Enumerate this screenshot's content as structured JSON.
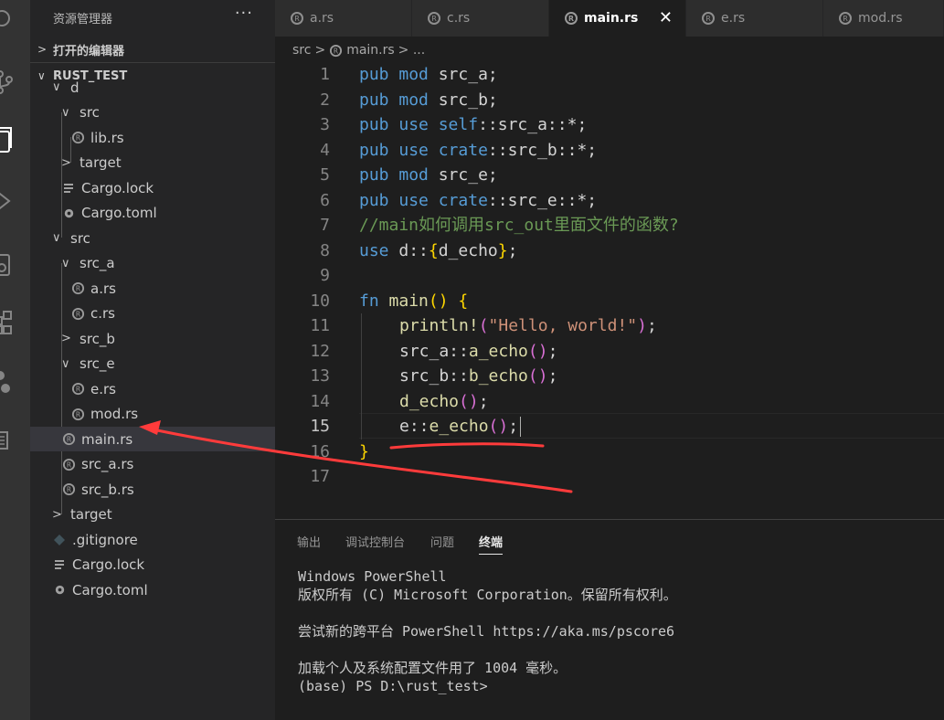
{
  "sidebar": {
    "title": "资源管理器",
    "more": "···",
    "open_editors": "打开的编辑器",
    "workspace": "RUST_TEST",
    "tree": [
      {
        "label": "d",
        "type": "folder",
        "open": true
      },
      {
        "label": "src",
        "type": "folder",
        "open": true
      },
      {
        "label": "lib.rs",
        "type": "rust"
      },
      {
        "label": "target",
        "type": "folder",
        "open": false
      },
      {
        "label": "Cargo.lock",
        "type": "lines"
      },
      {
        "label": "Cargo.toml",
        "type": "gear"
      },
      {
        "label": "src",
        "type": "folder",
        "open": true
      },
      {
        "label": "src_a",
        "type": "folder",
        "open": true
      },
      {
        "label": "a.rs",
        "type": "rust"
      },
      {
        "label": "c.rs",
        "type": "rust"
      },
      {
        "label": "src_b",
        "type": "folder",
        "open": false
      },
      {
        "label": "src_e",
        "type": "folder",
        "open": true
      },
      {
        "label": "e.rs",
        "type": "rust"
      },
      {
        "label": "mod.rs",
        "type": "rust"
      },
      {
        "label": "main.rs",
        "type": "rust"
      },
      {
        "label": "src_a.rs",
        "type": "rust"
      },
      {
        "label": "src_b.rs",
        "type": "rust"
      },
      {
        "label": "target",
        "type": "folder",
        "open": false
      },
      {
        "label": ".gitignore",
        "type": "diamond"
      },
      {
        "label": "Cargo.lock",
        "type": "lines"
      },
      {
        "label": "Cargo.toml",
        "type": "gear"
      }
    ]
  },
  "tabs": [
    {
      "label": "a.rs"
    },
    {
      "label": "c.rs"
    },
    {
      "label": "main.rs"
    },
    {
      "label": "e.rs"
    },
    {
      "label": "mod.rs"
    }
  ],
  "tab_close": "✕",
  "breadcrumb": {
    "part1": "src",
    "sep": ">",
    "file": "main.rs",
    "rest": "> ..."
  },
  "editor": {
    "line_numbers": [
      "1",
      "2",
      "3",
      "4",
      "5",
      "6",
      "7",
      "8",
      "9",
      "10",
      "11",
      "12",
      "13",
      "14",
      "15",
      "16",
      "17"
    ],
    "line1": {
      "a": "pub",
      "b": "mod",
      "c": "src_a;"
    },
    "line2": {
      "a": "pub",
      "b": "mod",
      "c": "src_b;"
    },
    "line3": {
      "a": "pub",
      "b": "use",
      "c": "self",
      "d": "::src_a::*;"
    },
    "line4": {
      "a": "pub",
      "b": "use",
      "c": "crate",
      "d": "::src_b::*;"
    },
    "line5": {
      "a": "pub",
      "b": "mod",
      "c": "src_e;"
    },
    "line6": {
      "a": "pub",
      "b": "use",
      "c": "crate",
      "d": "::src_e::*;"
    },
    "line7": "//main如何调用src_out里面文件的函数?",
    "line8": {
      "a": "use",
      "b": " d::",
      "c": "{",
      "d": "d_echo",
      "e": "}",
      "f": ";"
    },
    "line10": {
      "a": "fn",
      "b": "main",
      "c": "()",
      "d": "{"
    },
    "line11": {
      "a": "println!",
      "b": "(",
      "c": "\"Hello, world!\"",
      "d": ")",
      "e": ";"
    },
    "line12": {
      "a": "src_a::",
      "b": "a_echo",
      "c": "()",
      "d": ";"
    },
    "line13": {
      "a": "src_b::",
      "b": "b_echo",
      "c": "()",
      "d": ";"
    },
    "line14": {
      "a": "d_echo",
      "b": "()",
      "c": ";"
    },
    "line15": {
      "a": "e::",
      "b": "e_echo",
      "c": "()",
      "d": ";"
    },
    "line16": "}"
  },
  "panel": {
    "tabs": [
      "输出",
      "调试控制台",
      "问题",
      "终端"
    ],
    "terminal": [
      "Windows PowerShell",
      "版权所有 (C) Microsoft Corporation。保留所有权利。",
      "",
      "尝试新的跨平台 PowerShell https://aka.ms/pscore6",
      "",
      "加载个人及系统配置文件用了 1004 毫秒。",
      "(base) PS D:\\rust_test>"
    ]
  },
  "colors": {
    "annotation": "#ff3b3b",
    "keyword": "#569cd6",
    "function": "#dcdcaa",
    "string": "#ce9178",
    "comment": "#6a9955"
  }
}
